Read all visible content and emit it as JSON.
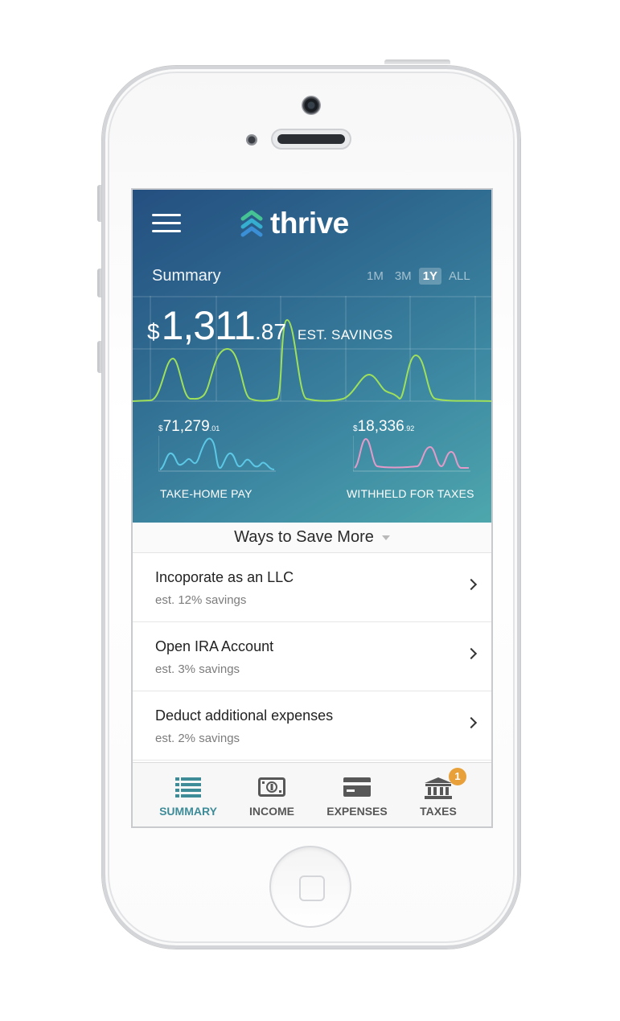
{
  "app": {
    "name": "thrive"
  },
  "summary": {
    "title": "Summary",
    "ranges": [
      "1M",
      "3M",
      "1Y",
      "ALL"
    ],
    "active_range": "1Y",
    "savings": {
      "currency": "$",
      "whole": "1,311",
      "cents": ".87",
      "label": "EST. SAVINGS"
    },
    "take_home": {
      "currency": "$",
      "whole": "71,279",
      "cents": ".01",
      "label": "TAKE-HOME PAY"
    },
    "withheld": {
      "currency": "$",
      "whole": "18,336",
      "cents": ".92",
      "label": "WITHHELD FOR TAXES"
    }
  },
  "ways_to_save": {
    "header": "Ways to Save More",
    "items": [
      {
        "title": "Incoporate as an LLC",
        "subtitle": "est. 12% savings"
      },
      {
        "title": "Open IRA Account",
        "subtitle": "est. 3% savings"
      },
      {
        "title": "Deduct additional expenses",
        "subtitle": "est. 2% savings"
      }
    ]
  },
  "tabbar": {
    "tabs": [
      {
        "label": "SUMMARY",
        "icon": "list-icon",
        "active": true
      },
      {
        "label": "INCOME",
        "icon": "banknote-icon"
      },
      {
        "label": "EXPENSES",
        "icon": "credit-card-icon"
      },
      {
        "label": "TAXES",
        "icon": "bank-icon",
        "badge": "1"
      }
    ]
  },
  "colors": {
    "hero_gradient_start": "#244f80",
    "hero_gradient_end": "#4ea7ad",
    "savings_line": "#9fe05a",
    "take_home_line": "#5cc8e6",
    "withheld_line": "#e49ac8",
    "accent": "#3f8c99",
    "badge": "#e8a13a"
  }
}
